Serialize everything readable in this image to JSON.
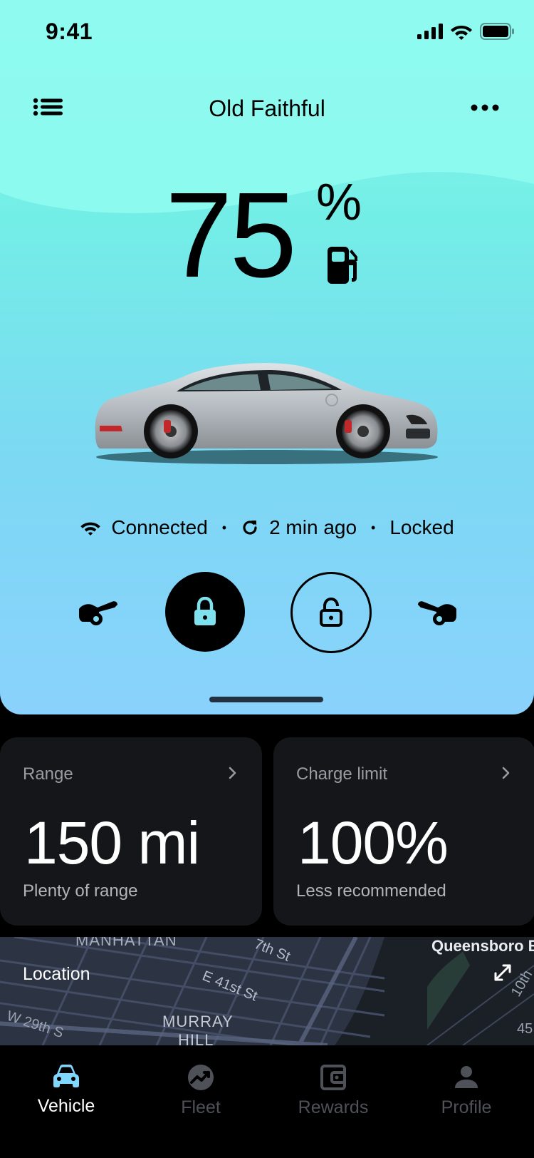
{
  "status_bar": {
    "time": "9:41"
  },
  "header": {
    "title": "Old Faithful"
  },
  "battery": {
    "level": "75",
    "unit": "%"
  },
  "vehicle_status": {
    "connection": "Connected",
    "last_update": "2 min ago",
    "lock_state": "Locked",
    "separator": "•"
  },
  "cards": {
    "range": {
      "label": "Range",
      "value": "150 mi",
      "subtitle": "Plenty of range"
    },
    "charge_limit": {
      "label": "Charge limit",
      "value": "100%",
      "subtitle": "Less recommended"
    }
  },
  "map": {
    "title": "Location",
    "labels": [
      "MANHATTAN",
      "Queensboro B",
      "E 41st St",
      "7th St",
      "MURRAY",
      "HILL",
      "W 29th S",
      "10th",
      "45"
    ]
  },
  "tabs": [
    {
      "label": "Vehicle",
      "icon": "car-icon",
      "active": true
    },
    {
      "label": "Fleet",
      "icon": "fleet-icon",
      "active": false
    },
    {
      "label": "Rewards",
      "icon": "wallet-icon",
      "active": false
    },
    {
      "label": "Profile",
      "icon": "person-icon",
      "active": false
    }
  ],
  "colors": {
    "hero_top": "#8ffbf0",
    "hero_bottom": "#8ad2fd",
    "card_bg": "#15161a",
    "tab_active_icon": "#7fd6ff",
    "tab_inactive": "#4f5159"
  }
}
